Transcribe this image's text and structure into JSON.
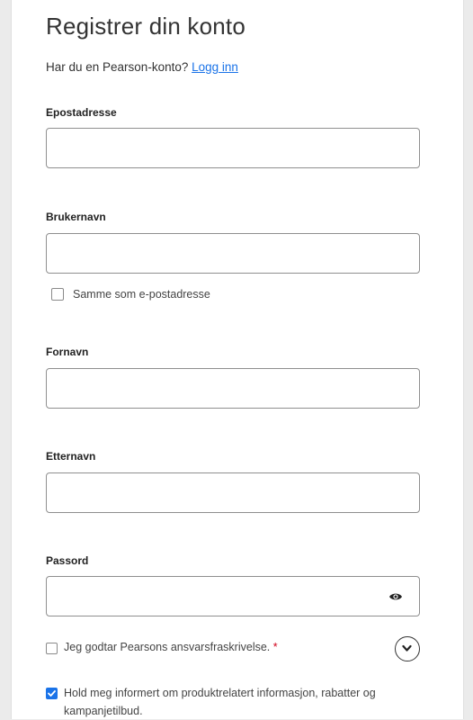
{
  "form": {
    "title": "Registrer din konto",
    "have_account_text": "Har du en Pearson-konto?",
    "login_link": "Logg inn",
    "fields": {
      "email": {
        "label": "Epostadresse",
        "value": ""
      },
      "username": {
        "label": "Brukernavn",
        "value": ""
      },
      "same_as_email": {
        "label": "Samme som e-postadresse",
        "checked": false
      },
      "first_name": {
        "label": "Fornavn",
        "value": ""
      },
      "last_name": {
        "label": "Etternavn",
        "value": ""
      },
      "password": {
        "label": "Passord",
        "value": ""
      }
    },
    "terms": {
      "label": "Jeg godtar Pearsons ansvarsfraskrivelse.",
      "required_mark": "*",
      "checked": false
    },
    "marketing": {
      "label": "Hold meg informert om produktrelatert informasjon, rabatter og kampanjetilbud.",
      "checked": true
    }
  },
  "icons": {
    "password_toggle": "eye-icon",
    "expand_terms": "chevron-down-icon"
  },
  "colors": {
    "link": "#1a73e8",
    "checkbox_checked": "#1a73e8",
    "required": "#d0021b"
  }
}
